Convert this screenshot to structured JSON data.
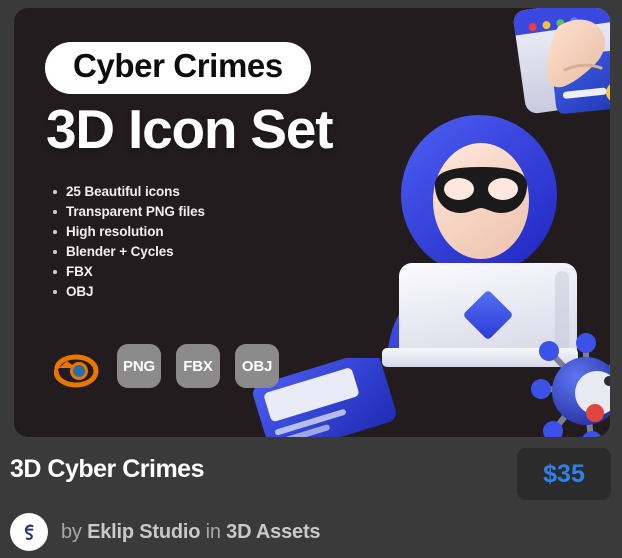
{
  "preview": {
    "category_pill": "Cyber Crimes",
    "headline": "3D Icon Set",
    "features": [
      "25 Beautiful icons",
      "Transparent PNG files",
      "High resolution",
      "Blender + Cycles",
      "FBX",
      "OBJ"
    ],
    "formats": {
      "software_icon": "blender-logo-icon",
      "badges": [
        "PNG",
        "FBX",
        "OBJ"
      ]
    },
    "artwork": {
      "hacker": "hacker-with-laptop-3d-icon",
      "card_hand": "hand-holding-credit-card-3d-icon",
      "credit_cards": "stacked-credit-cards-3d-icon",
      "virus": "virus-malware-3d-icon"
    }
  },
  "listing": {
    "title": "3D Cyber Crimes",
    "price": "$35",
    "byline_prefix": "by",
    "author": "Eklip Studio",
    "byline_middle": "in",
    "category": "3D Assets",
    "avatar": "eklip-studio-avatar-icon"
  },
  "colors": {
    "page_background": "#3a3a3a",
    "card_background": "#221c1e",
    "pill_background": "#ffffff",
    "badge_background": "#8b8b8b",
    "price_text": "#2f80ed",
    "price_background": "#2b2b2b",
    "accent_blue": "#3a48e0",
    "blender_orange": "#ea7600"
  }
}
